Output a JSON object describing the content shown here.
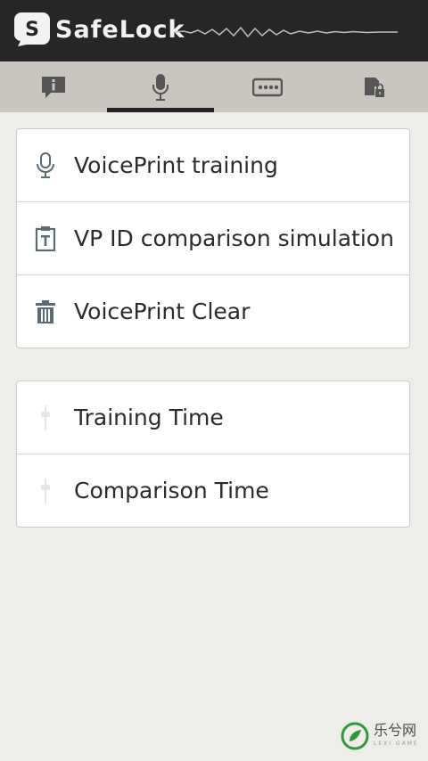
{
  "app": {
    "title": "SafeLock",
    "colors": {
      "titlebar": "#262626",
      "tabbar": "#c9c6c0",
      "background": "#efede9",
      "icon": "#5b6b73"
    }
  },
  "tabs": [
    {
      "icon": "info-bubble-icon",
      "selected": false
    },
    {
      "icon": "microphone-icon",
      "selected": true
    },
    {
      "icon": "password-dots-icon",
      "selected": false
    },
    {
      "icon": "device-lock-icon",
      "selected": false
    }
  ],
  "section1": {
    "items": [
      {
        "label": "VoicePrint training",
        "icon": "microphone-icon"
      },
      {
        "label": "VP ID comparison simulation",
        "icon": "id-card-icon"
      },
      {
        "label": "VoicePrint Clear",
        "icon": "trash-icon"
      }
    ]
  },
  "section2": {
    "items": [
      {
        "label": "Training Time",
        "icon": "slider-icon"
      },
      {
        "label": "Comparison Time",
        "icon": "slider-icon"
      }
    ]
  },
  "watermark": {
    "text": "乐兮网",
    "subtext": "LEXI GAME"
  }
}
